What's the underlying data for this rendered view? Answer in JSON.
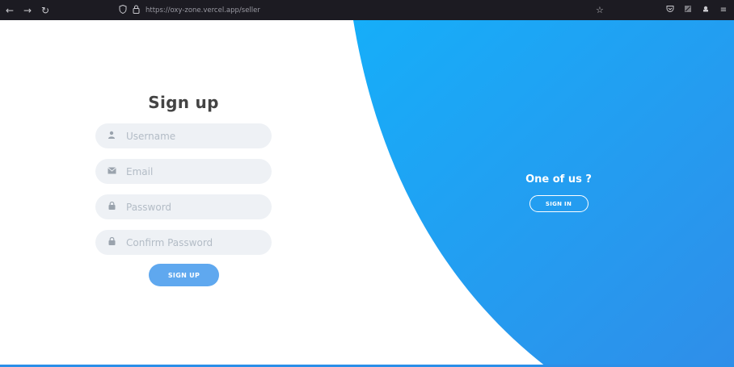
{
  "browser": {
    "url": "https://oxy-zone.vercel.app/seller",
    "back_icon": "arrow-left",
    "forward_icon": "arrow-right",
    "reload_icon": "reload",
    "shield_icon": "shield",
    "lock_icon": "lock"
  },
  "signup": {
    "title": "Sign up",
    "fields": [
      {
        "icon": "user-icon",
        "placeholder": "Username",
        "type": "text"
      },
      {
        "icon": "envelope-icon",
        "placeholder": "Email",
        "type": "email"
      },
      {
        "icon": "lock-icon",
        "placeholder": "Password",
        "type": "password"
      },
      {
        "icon": "lock-icon",
        "placeholder": "Confirm Password",
        "type": "password"
      }
    ],
    "submit_label": "SIGN UP"
  },
  "signin_panel": {
    "heading": "One of us ?",
    "button_label": "SIGN IN"
  },
  "colors": {
    "accent_blue": "#1ea7f7",
    "button_blue": "#5fa8ef",
    "input_bg": "#eef1f5",
    "chrome_bg": "#1c1b22"
  }
}
